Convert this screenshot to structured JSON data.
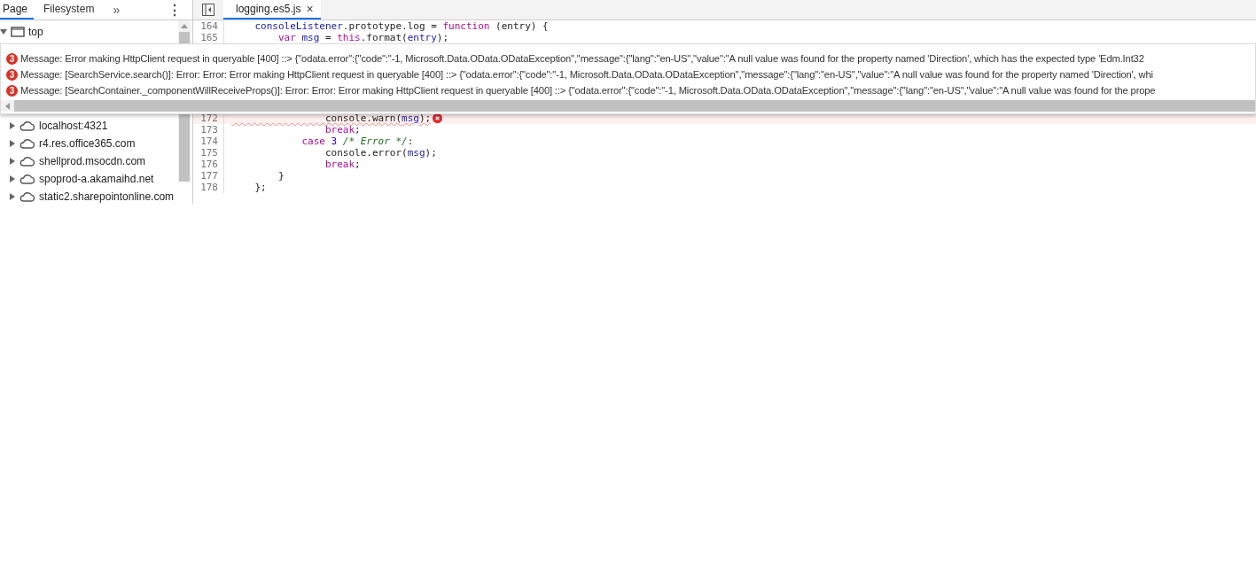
{
  "navigator_tabs": [
    {
      "label": "Page",
      "selected": true
    },
    {
      "label": "Filesystem",
      "selected": false
    }
  ],
  "more_tabs": "»",
  "menu": "⋮",
  "tree": [
    {
      "label": "top",
      "kind": "frame",
      "expanded": true
    },
    {
      "label": "localhost:4321",
      "kind": "domain",
      "expanded": false
    },
    {
      "label": "r4.res.office365.com",
      "kind": "domain",
      "expanded": false
    },
    {
      "label": "shellprod.msocdn.com",
      "kind": "domain",
      "expanded": false
    },
    {
      "label": "spoprod-a.akamaihd.net",
      "kind": "domain",
      "expanded": false
    },
    {
      "label": "static2.sharepointonline.com",
      "kind": "domain",
      "expanded": false
    }
  ],
  "editor_tabs": [
    {
      "label": "logging.es5.js",
      "selected": true,
      "close": "×"
    }
  ],
  "code": [
    {
      "line": "164",
      "error": false,
      "segments": [
        {
          "kind": "ident",
          "text": "    consoleListener"
        },
        {
          "kind": "plain",
          "text": ".prototype.log = "
        },
        {
          "kind": "keyword",
          "text": "function"
        },
        {
          "kind": "plain",
          "text": " (entry) {"
        }
      ]
    },
    {
      "line": "165",
      "error": false,
      "segments": [
        {
          "kind": "keyword",
          "text": "        var"
        },
        {
          "kind": "ident",
          "text": " msg"
        },
        {
          "kind": "plain",
          "text": " = "
        },
        {
          "kind": "keyword",
          "text": "this"
        },
        {
          "kind": "plain",
          "text": ".format("
        },
        {
          "kind": "ident",
          "text": "entry"
        },
        {
          "kind": "plain",
          "text": ");"
        }
      ]
    },
    {
      "line": "172",
      "error": true,
      "segments": [
        {
          "kind": "plain",
          "text": "                console.warn("
        },
        {
          "kind": "ident",
          "text": "msg"
        },
        {
          "kind": "plain",
          "text": ");"
        }
      ]
    },
    {
      "line": "173",
      "error": false,
      "segments": [
        {
          "kind": "keyword",
          "text": "                break"
        },
        {
          "kind": "plain",
          "text": ";"
        }
      ]
    },
    {
      "line": "174",
      "error": false,
      "segments": [
        {
          "kind": "keyword",
          "text": "            case"
        },
        {
          "kind": "number",
          "text": " 3"
        },
        {
          "kind": "comment",
          "text": " /* Error */"
        },
        {
          "kind": "plain",
          "text": ":"
        }
      ]
    },
    {
      "line": "175",
      "error": false,
      "segments": [
        {
          "kind": "plain",
          "text": "                console.error("
        },
        {
          "kind": "ident",
          "text": "msg"
        },
        {
          "kind": "plain",
          "text": ");"
        }
      ]
    },
    {
      "line": "176",
      "error": false,
      "segments": [
        {
          "kind": "keyword",
          "text": "                break"
        },
        {
          "kind": "plain",
          "text": ";"
        }
      ]
    },
    {
      "line": "177",
      "error": false,
      "segments": [
        {
          "kind": "plain",
          "text": "        }"
        }
      ]
    },
    {
      "line": "178",
      "error": false,
      "segments": [
        {
          "kind": "plain",
          "text": "    };"
        }
      ]
    }
  ],
  "error_popover": {
    "messages": [
      {
        "count": "3",
        "text": "Message: Error making HttpClient request in queryable [400] ::> {\"odata.error\":{\"code\":\"-1, Microsoft.Data.OData.ODataException\",\"message\":{\"lang\":\"en-US\",\"value\":\"A null value was found for the property named 'Direction', which has the expected type 'Edm.Int32"
      },
      {
        "count": "3",
        "text": "Message: [SearchService.search()]: Error: Error: Error making HttpClient request in queryable [400] ::> {\"odata.error\":{\"code\":\"-1, Microsoft.Data.OData.ODataException\",\"message\":{\"lang\":\"en-US\",\"value\":\"A null value was found for the property named 'Direction', whi"
      },
      {
        "count": "3",
        "text": "Message: [SearchContainer._componentWillReceiveProps()]: Error: Error: Error making HttpClient request in queryable [400] ::> {\"odata.error\":{\"code\":\"-1, Microsoft.Data.OData.ODataException\",\"message\":{\"lang\":\"en-US\",\"value\":\"A null value was found for the prope"
      }
    ]
  }
}
